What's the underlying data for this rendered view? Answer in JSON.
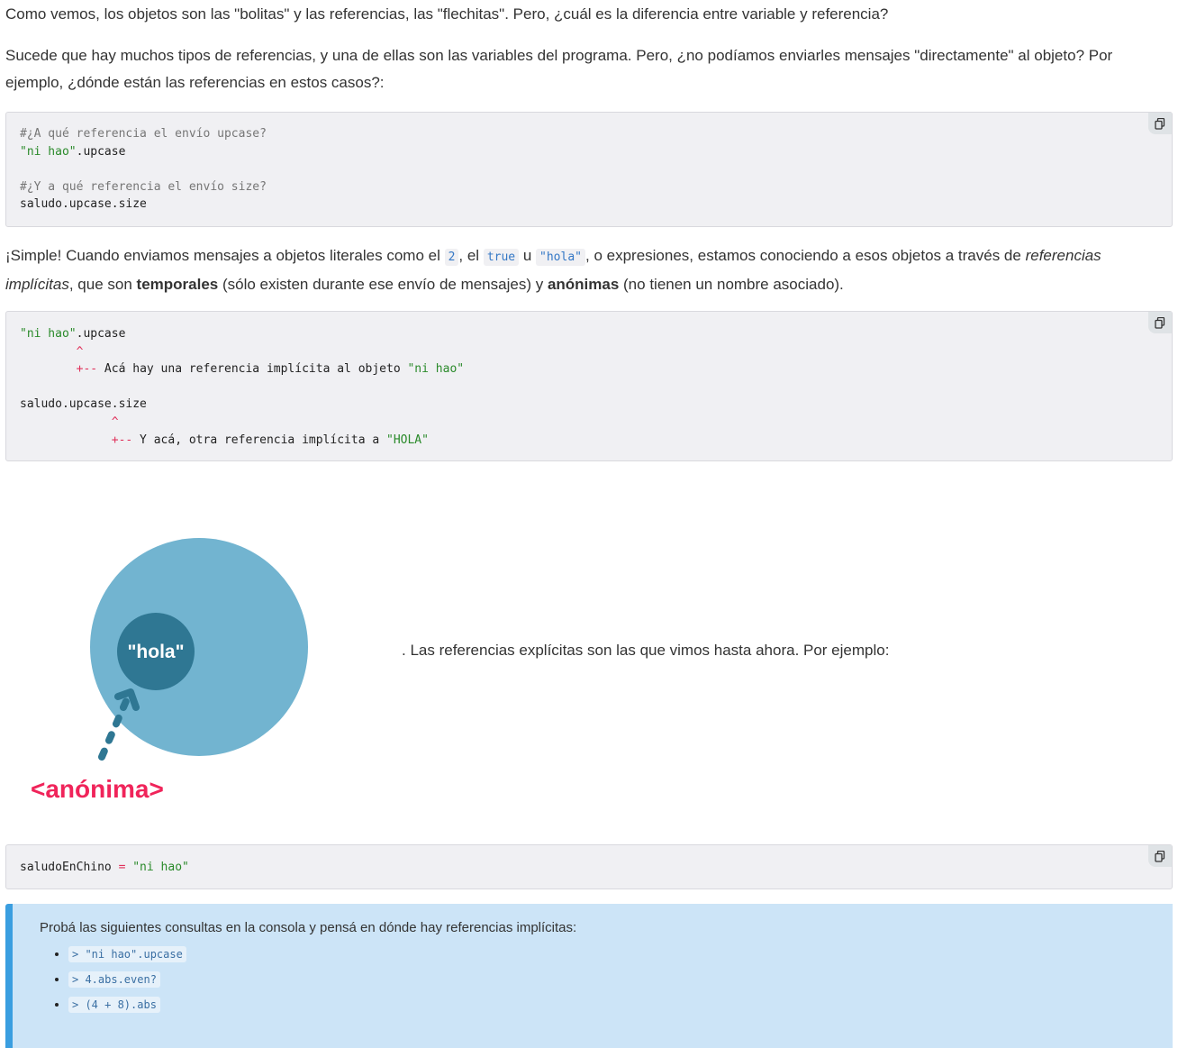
{
  "paragraphs": {
    "intro": "Como vemos, los objetos son las \"bolitas\" y las referencias, las \"flechitas\". Pero, ¿cuál es la diferencia entre variable y referencia?",
    "question": "Sucede que hay muchos tipos de referencias, y una de ellas son las variables del programa. Pero, ¿no podíamos enviarles mensajes \"directamente\" al objeto? Por ejemplo, ¿dónde están las referencias en estos casos?:",
    "simple_a": "¡Simple! Cuando enviamos mensajes a objetos literales como el ",
    "inline_2": "2",
    "simple_b": ", el ",
    "inline_true": "true",
    "simple_c": " u ",
    "inline_hola": "\"hola\"",
    "simple_d": ", o expresiones, estamos conociendo a esos objetos a través de ",
    "simple_em": "referencias implícitas",
    "simple_e": ", que son ",
    "simple_bold1": "temporales",
    "simple_f": " (sólo existen durante ese envío de mensajes) y ",
    "simple_bold2": "anónimas",
    "simple_g": " (no tienen un nombre asociado).",
    "explicit": ". Las referencias explícitas son las que vimos hasta ahora. Por ejemplo:"
  },
  "code1": {
    "comment1": "#¿A qué referencia el envío upcase?",
    "str1": "\"ni hao\"",
    "method1": ".upcase",
    "comment2": "#¿Y a qué referencia el envío size?",
    "line4": "saludo.upcase.size"
  },
  "code2": {
    "str1": "\"ni hao\"",
    "method1": ".upcase",
    "caret": "^",
    "arrow": "+--",
    "note1": " Acá hay una referencia implícita al objeto ",
    "note1_str": "\"ni hao\"",
    "line3": "saludo.upcase.size",
    "note2": " Y acá, otra referencia implícita a ",
    "note2_str": "\"HOLA\""
  },
  "diagram": {
    "inner_label": "\"hola\"",
    "ref_label": "<anónima>",
    "outer_color": "#72b4d0",
    "inner_color": "#2f7793",
    "ref_color": "#f0245a"
  },
  "code3": {
    "var": "saludoEnChino",
    "op": " = ",
    "str": "\"ni hao\""
  },
  "note": {
    "title": "Probá las siguientes consultas en la consola y pensá en dónde hay referencias implícitas:",
    "items": [
      "> \"ni hao\".upcase",
      "> 4.abs.even?",
      "> (4 + 8).abs"
    ]
  },
  "icons": {
    "copy": "copy-icon"
  }
}
